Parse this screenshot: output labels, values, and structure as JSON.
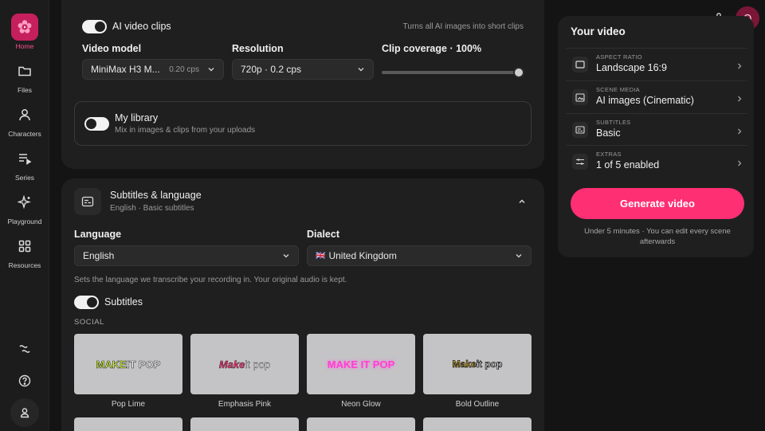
{
  "sidebar": {
    "items": [
      {
        "label": "Home",
        "icon": "flower-icon"
      },
      {
        "label": "Files",
        "icon": "folder-icon"
      },
      {
        "label": "Characters",
        "icon": "person-icon"
      },
      {
        "label": "Series",
        "icon": "playlist-icon"
      },
      {
        "label": "Playground",
        "icon": "sparkle-icon"
      },
      {
        "label": "Resources",
        "icon": "grid-icon"
      }
    ]
  },
  "visuals": {
    "ai_clips_label": "AI video clips",
    "ai_clips_on": true,
    "ai_clips_hint": "Turns all AI images into short clips",
    "video_model_label": "Video model",
    "video_model_value": "MiniMax H3 M...",
    "video_model_cost": "0.20 cps",
    "resolution_label": "Resolution",
    "resolution_value": "720p · 0.2 cps",
    "clip_coverage_label": "Clip coverage · 100%",
    "clip_coverage_value": 100,
    "library_title": "My library",
    "library_sub": "Mix in images & clips from your uploads",
    "library_on": false
  },
  "subtitles_section": {
    "title": "Subtitles & language",
    "summary": "English · Basic subtitles",
    "language_label": "Language",
    "language_value": "English",
    "dialect_label": "Dialect",
    "dialect_flag": "🇬🇧",
    "dialect_value": "United Kingdom",
    "language_hint": "Sets the language we transcribe your recording in. Your original audio is kept.",
    "subtitles_label": "Subtitles",
    "subtitles_on": true,
    "group_label": "SOCIAL",
    "presets": [
      {
        "name": "Pop Lime",
        "sample_a": "MAKE",
        "sample_b": " IT POP"
      },
      {
        "name": "Emphasis Pink",
        "sample_a": "Make",
        "sample_b": " it pop"
      },
      {
        "name": "Neon Glow",
        "sample_a": "MAKE IT POP",
        "sample_b": ""
      },
      {
        "name": "Bold Outline",
        "sample_a": "Make",
        "sample_b": " it pop"
      }
    ]
  },
  "your_video": {
    "title": "Your video",
    "rows": [
      {
        "label": "ASPECT RATIO",
        "value": "Landscape 16:9",
        "icon": "aspect-ratio-icon"
      },
      {
        "label": "SCENE MEDIA",
        "value": "AI images (Cinematic)",
        "icon": "images-icon"
      },
      {
        "label": "SUBTITLES",
        "value": "Basic",
        "icon": "subtitles-icon"
      },
      {
        "label": "EXTRAS",
        "value": "1 of 5 enabled",
        "icon": "sliders-icon"
      }
    ],
    "generate_label": "Generate video",
    "note": "Under 5 minutes · You can edit every scene afterwards"
  },
  "colors": {
    "accent": "#ff2f74",
    "active_nav": "#c51f5d"
  }
}
